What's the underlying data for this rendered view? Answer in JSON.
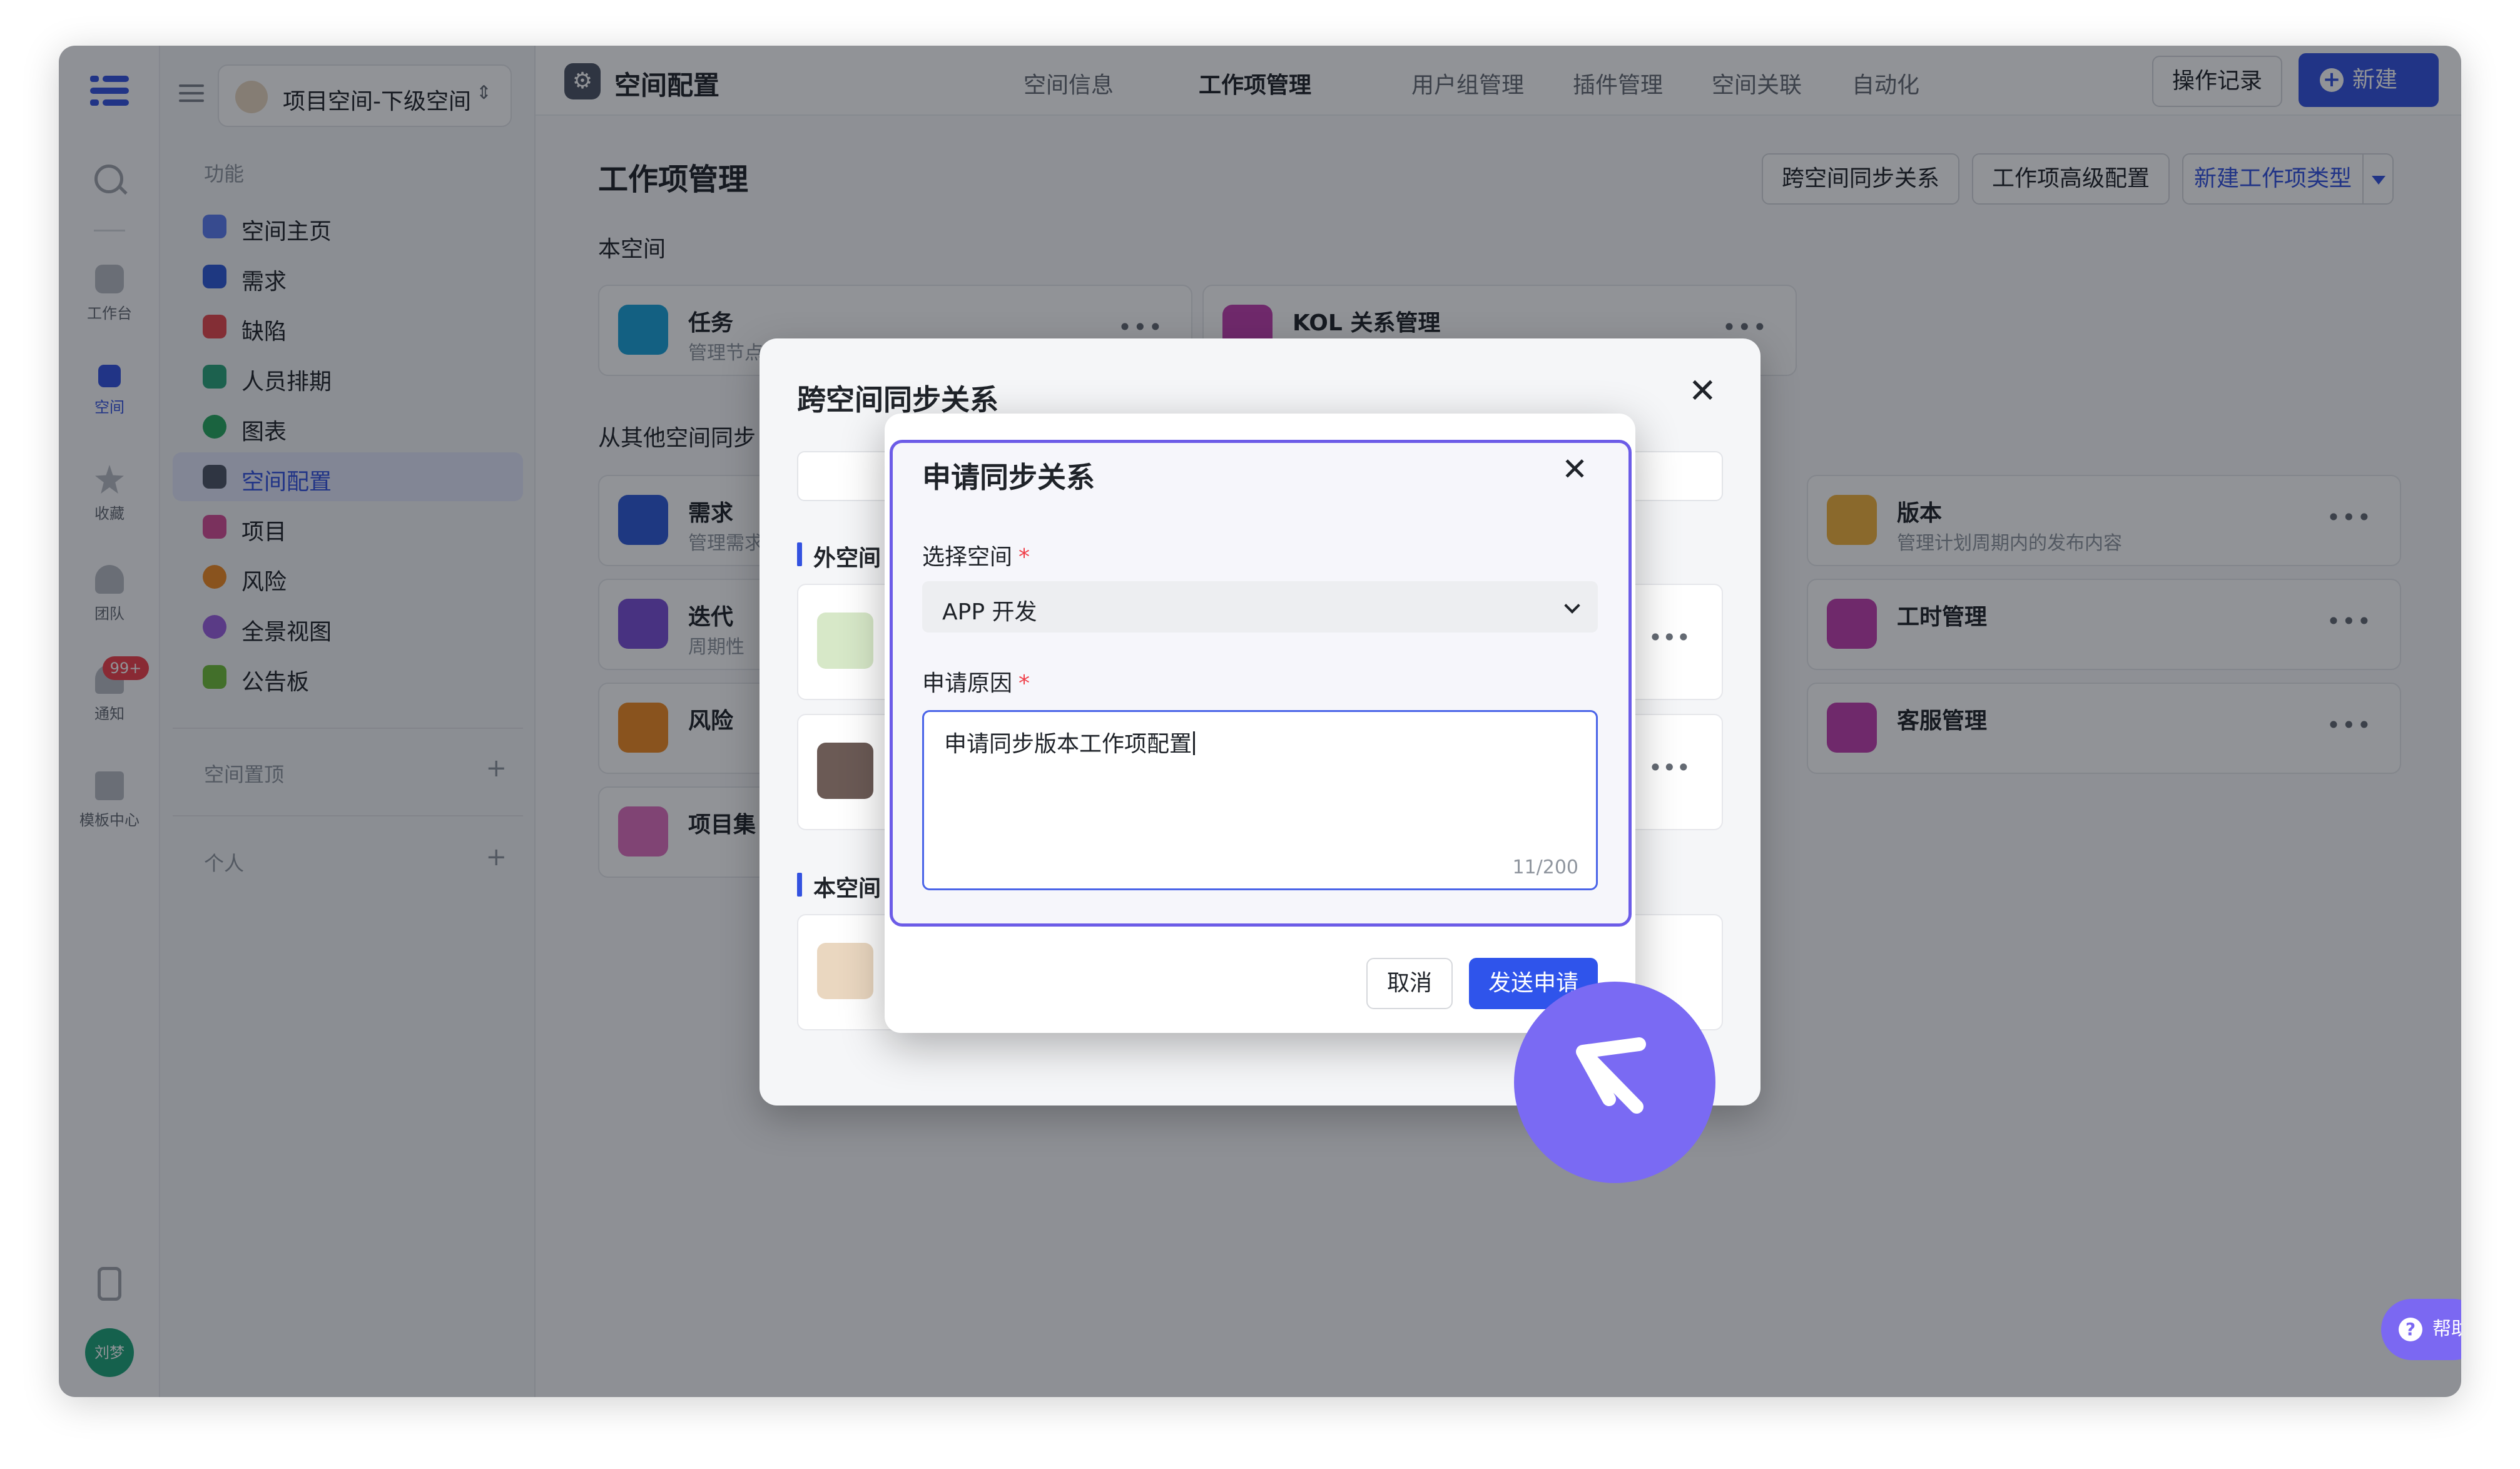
{
  "rail": {
    "items": [
      {
        "label": "工作台",
        "icon": "home-icon"
      },
      {
        "label": "空间",
        "icon": "space-icon"
      },
      {
        "label": "收藏",
        "icon": "star-icon"
      },
      {
        "label": "团队",
        "icon": "team-icon"
      },
      {
        "label": "通知",
        "icon": "bell-icon"
      },
      {
        "label": "模板中心",
        "icon": "template-icon"
      }
    ],
    "notification_badge": "99+",
    "avatar": "刘梦"
  },
  "sidebar": {
    "space_name": "项目空间-下级空间",
    "section_label": "功能",
    "items": [
      {
        "label": "空间主页",
        "color": "#5b7cf0"
      },
      {
        "label": "需求",
        "color": "#2f5ad8"
      },
      {
        "label": "缺陷",
        "color": "#e5484d"
      },
      {
        "label": "人员排期",
        "color": "#2aa57a"
      },
      {
        "label": "图表",
        "color": "#27a85f"
      },
      {
        "label": "空间配置",
        "color": "#4e5565"
      },
      {
        "label": "项目",
        "color": "#d64d96"
      },
      {
        "label": "风险",
        "color": "#f08a24"
      },
      {
        "label": "全景视图",
        "color": "#9b5fe0"
      },
      {
        "label": "公告板",
        "color": "#6fbe39"
      }
    ],
    "pinned_label": "空间置顶",
    "personal_label": "个人"
  },
  "topbar": {
    "title": "空间配置",
    "tabs": [
      "空间信息",
      "工作项管理",
      "用户组管理",
      "插件管理",
      "空间关联",
      "自动化"
    ],
    "active_tab": "工作项管理",
    "log_button": "操作记录",
    "new_button": "新建"
  },
  "content": {
    "title": "工作项管理",
    "buttons": [
      "跨空间同步关系",
      "工作项高级配置",
      "新建工作项类型"
    ],
    "this_space_label": "本空间",
    "other_space_label": "从其他空间同步",
    "cards": [
      {
        "title": "任务",
        "desc": "管理节点",
        "color": "#1aa3d9"
      },
      {
        "title": "KOL 关系管理",
        "desc": "",
        "color": "#c23fb0"
      },
      {
        "title": "需求",
        "desc": "管理需求",
        "color": "#2f5ad8"
      },
      {
        "title": "版本",
        "desc": "管理计划周期内的发布内容",
        "color": "#f2b33d"
      },
      {
        "title": "迭代",
        "desc": "周期性",
        "color": "#7b4fd8"
      },
      {
        "title": "工时管理",
        "desc": "",
        "color": "#c23fb0"
      },
      {
        "title": "风险",
        "desc": "",
        "color": "#f08a24"
      },
      {
        "title": "客服管理",
        "desc": "",
        "color": "#c23fb0"
      },
      {
        "title": "项目集",
        "desc": "",
        "color": "#e06fbf"
      }
    ]
  },
  "bg_dialog": {
    "title": "跨空间同步关系",
    "section_external": "外空间",
    "section_local": "本空间"
  },
  "dialog": {
    "title": "申请同步关系",
    "space_label": "选择空间",
    "space_value": "APP 开发",
    "reason_label": "申请原因",
    "required_mark": "*",
    "reason_value": "申请同步版本工作项配置",
    "char_count": "11/200",
    "cancel": "取消",
    "send": "发送申请"
  },
  "help_button": "帮助",
  "colors": {
    "primary": "#3352e0",
    "cursor": "#7a6af3",
    "highlight": "#6c5ce7"
  }
}
